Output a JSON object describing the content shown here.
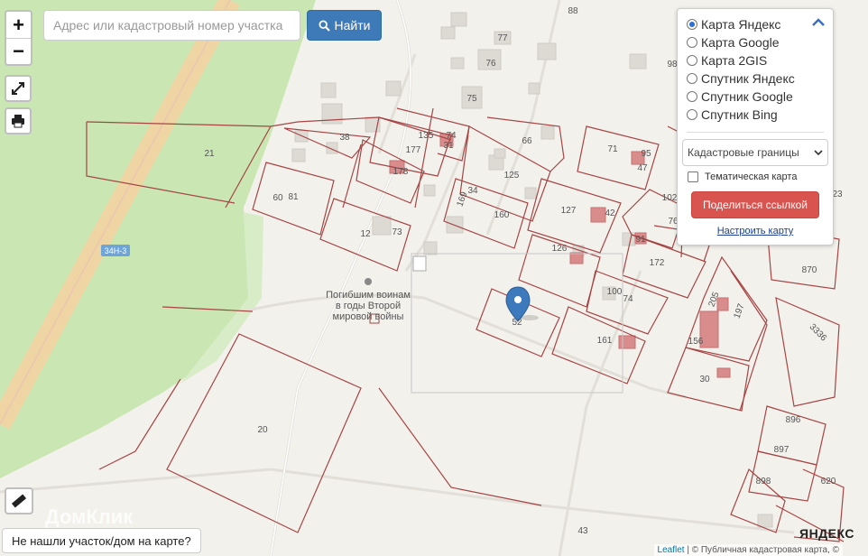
{
  "search": {
    "placeholder": "Адрес или кадастровый номер участка",
    "button_label": "Найти"
  },
  "controls": {
    "zoom_in": "+",
    "zoom_out": "−"
  },
  "layers": {
    "options": [
      {
        "label": "Карта Яндекс",
        "selected": true
      },
      {
        "label": "Карта Google",
        "selected": false
      },
      {
        "label": "Карта 2GIS",
        "selected": false
      },
      {
        "label": "Спутник Яндекс",
        "selected": false
      },
      {
        "label": "Спутник Google",
        "selected": false
      },
      {
        "label": "Спутник Bing",
        "selected": false
      }
    ],
    "overlay_select": "Кадастровые границы",
    "thematic_label": "Тематическая карта",
    "share_label": "Поделиться ссылкой",
    "configure_label": "Настроить карту"
  },
  "map": {
    "road_label": "34Н-3",
    "memorial_label": "Погибшим воинам\nв годы Второй\nмировой войны",
    "parcels": [
      "21",
      "38",
      "135",
      "74",
      "31",
      "177",
      "178",
      "66",
      "71",
      "95",
      "47",
      "81",
      "60",
      "125",
      "34",
      "169",
      "160",
      "127",
      "42",
      "12",
      "73",
      "126",
      "91",
      "172",
      "102",
      "76",
      "23",
      "870",
      "100",
      "74",
      "52",
      "161",
      "205",
      "197",
      "156",
      "30",
      "20",
      "896",
      "897",
      "898",
      "620",
      "43",
      "88",
      "77",
      "76",
      "75",
      "98",
      "3336"
    ],
    "selected_parcel": "52",
    "watermark": "ДомКлик",
    "provider": "ЯНДЕКС"
  },
  "not_found_label": "Не нашли участок/дом на карте?",
  "attribution": {
    "leaflet": "Leaflet",
    "rest": "| © Публичная кадастровая карта, ©"
  }
}
